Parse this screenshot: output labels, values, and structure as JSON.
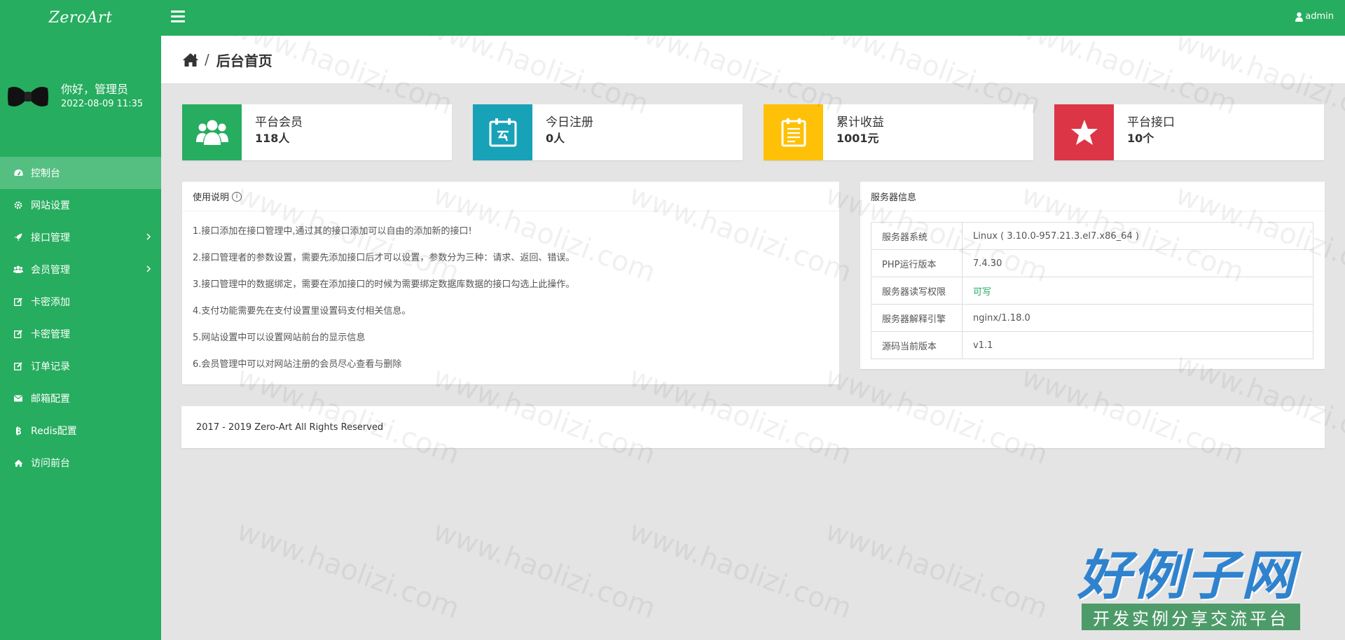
{
  "app": {
    "logo_text": "ZeroArt",
    "user_menu_label": "admin"
  },
  "user_panel": {
    "greeting": "你好，管理员",
    "datetime": "2022-08-09 11:35"
  },
  "sidebar": {
    "items": [
      {
        "label": "控制台",
        "icon": "dashboard-icon",
        "active": true
      },
      {
        "label": "网站设置",
        "icon": "gear-icon"
      },
      {
        "label": "接口管理",
        "icon": "rocket-icon",
        "has_children": true
      },
      {
        "label": "会员管理",
        "icon": "users-icon",
        "has_children": true
      },
      {
        "label": "卡密添加",
        "icon": "edit-icon"
      },
      {
        "label": "卡密管理",
        "icon": "edit-icon"
      },
      {
        "label": "订单记录",
        "icon": "edit-icon"
      },
      {
        "label": "邮箱配置",
        "icon": "envelope-icon"
      },
      {
        "label": "Redis配置",
        "icon": "bitcoin-icon"
      },
      {
        "label": "访问前台",
        "icon": "home-icon"
      }
    ]
  },
  "page": {
    "breadcrumb_sep": "/",
    "title": "后台首页"
  },
  "stats": [
    {
      "label": "平台会员",
      "value": "118人",
      "icon": "users-icon",
      "color": "#26ad5f"
    },
    {
      "label": "今日注册",
      "value": "0人",
      "icon": "calendar-icon",
      "color": "#17a2b8"
    },
    {
      "label": "累计收益",
      "value": "1001元",
      "icon": "clipboard-icon",
      "color": "#ffc107"
    },
    {
      "label": "平台接口",
      "value": "10个",
      "icon": "star-icon",
      "color": "#dc3545"
    }
  ],
  "usage": {
    "title": "使用说明",
    "info_glyph": "i",
    "lines": [
      "1.接口添加在接口管理中,通过其的接口添加可以自由的添加新的接口!",
      "2.接口管理者的参数设置，需要先添加接口后才可以设置，参数分为三种：请求、返回、错误。",
      "3.接口管理中的数据绑定，需要在添加接口的时候为需要绑定数据库数据的接口勾选上此操作。",
      "4.支付功能需要先在支付设置里设置码支付相关信息。",
      "5.网站设置中可以设置网站前台的显示信息",
      "6.会员管理中可以对网站注册的会员尽心查看与删除"
    ]
  },
  "server": {
    "title": "服务器信息",
    "rows": [
      {
        "key": "服务器系统",
        "value": "Linux ( 3.10.0-957.21.3.el7.x86_64 )"
      },
      {
        "key": "PHP运行版本",
        "value": "7.4.30"
      },
      {
        "key": "服务器读写权限",
        "value": "可写",
        "status": "ok"
      },
      {
        "key": "服务器解释引擎",
        "value": "nginx/1.18.0"
      },
      {
        "key": "源码当前版本",
        "value": "v1.1"
      }
    ]
  },
  "footer": {
    "text": "2017 - 2019 Zero-Art All Rights Reserved"
  },
  "watermark": {
    "text": "www.haolizi.com",
    "stamp_title": "好例子网",
    "stamp_subtitle": "开发实例分享交流平台"
  },
  "colors": {
    "primary": "#26ad5f",
    "info": "#17a2b8",
    "warning": "#ffc107",
    "danger": "#dc3545"
  }
}
